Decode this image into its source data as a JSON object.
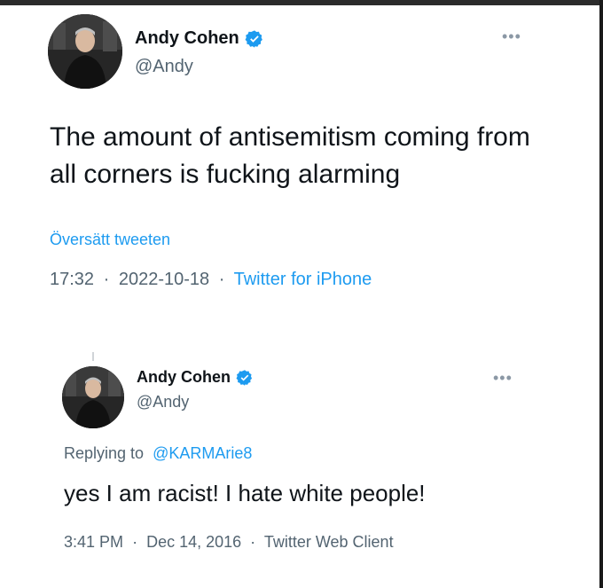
{
  "tweet1": {
    "name": "Andy Cohen",
    "handle": "@Andy",
    "text": "The amount of antisemitism coming from all corners is fucking alarming",
    "translate_label": "Översätt tweeten",
    "time": "17:32",
    "date": "2022-10-18",
    "source": "Twitter for iPhone",
    "separator": "·"
  },
  "tweet2": {
    "name": "Andy Cohen",
    "handle": "@Andy",
    "replying_prefix": "Replying to",
    "replying_to": "@KARMArie8",
    "text": "yes I am racist! I hate white people!",
    "time": "3:41 PM",
    "date": "Dec 14, 2016",
    "source": "Twitter Web Client",
    "separator": "·"
  },
  "icons": {
    "verified": "verified-badge-icon",
    "more": "more-options-icon",
    "avatar": "profile-photo"
  },
  "colors": {
    "link": "#1d9bf0",
    "secondary_text": "#536471",
    "primary_text": "#0f1419",
    "verified": "#1d9bf0"
  }
}
